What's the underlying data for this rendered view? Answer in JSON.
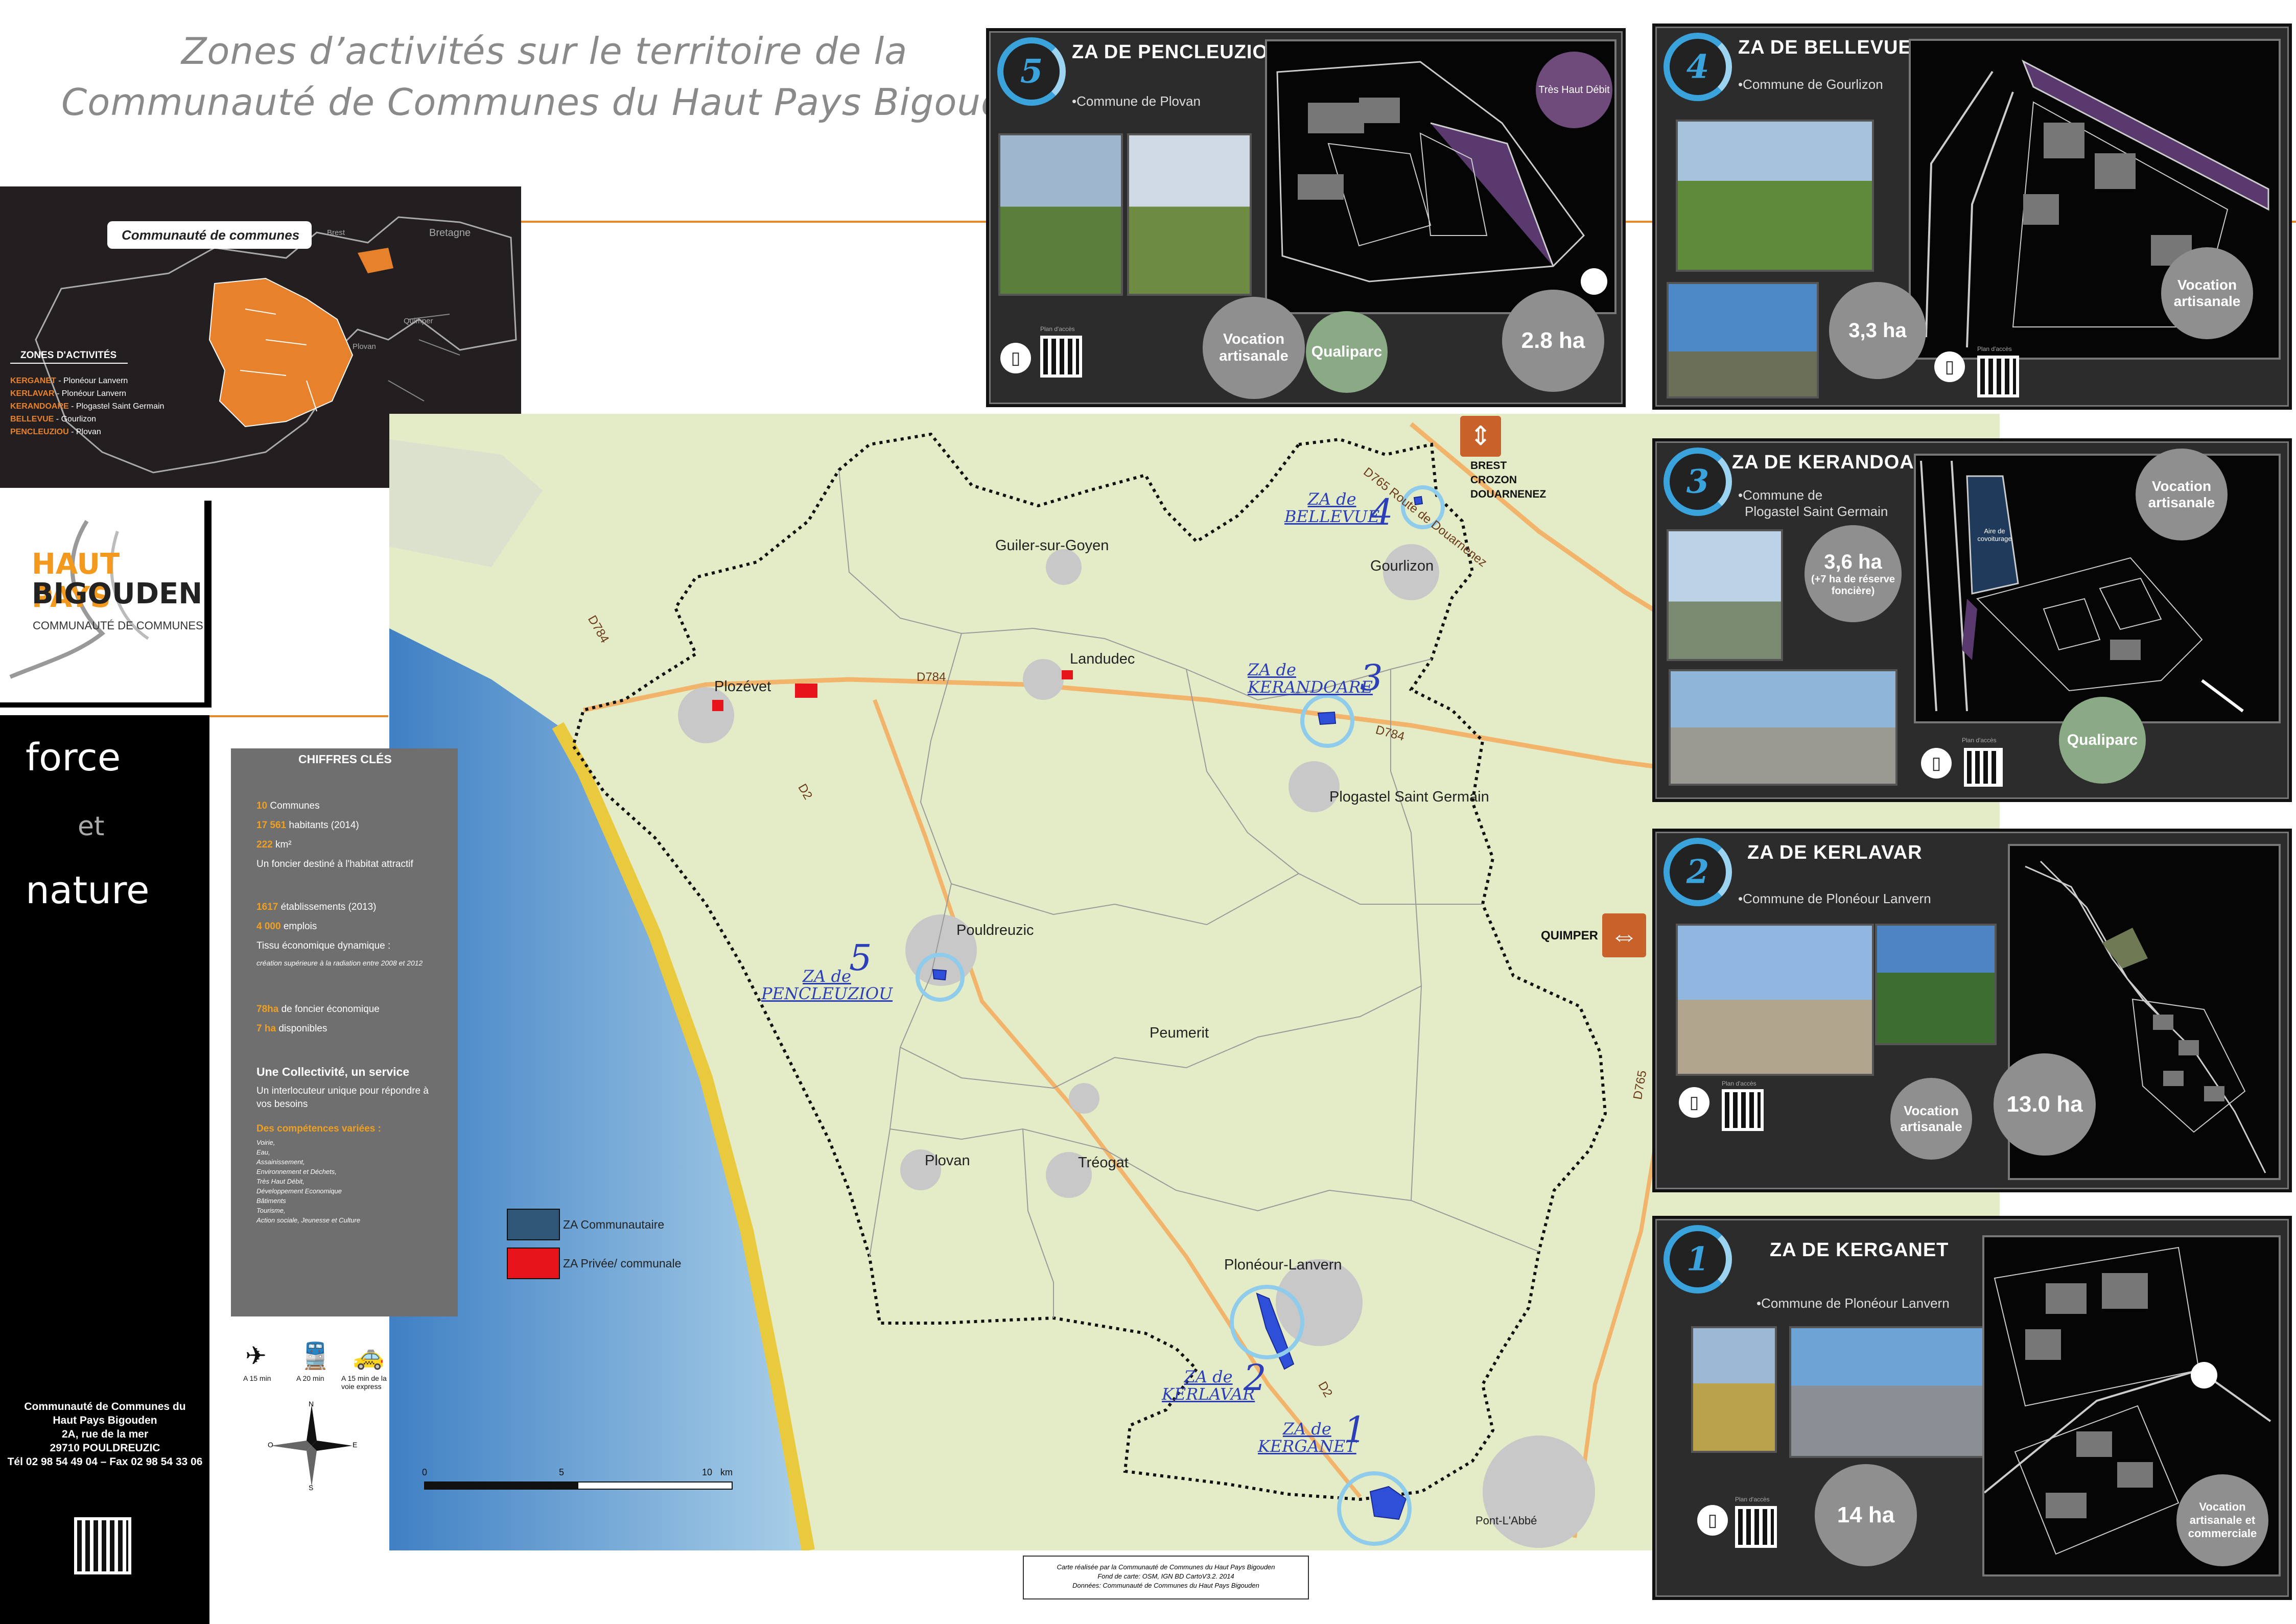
{
  "title": {
    "line1": "Zones d’activités sur le territoire de la",
    "line2": "Communauté de Communes du Haut Pays Bigouden"
  },
  "inset_map": {
    "heading": "Communauté de communes",
    "towns": [
      "Brest",
      "Quimper",
      "Plovan"
    ],
    "regions": [
      "Bretagne"
    ],
    "legend_title": "ZONES D'ACTIVITÉS",
    "legend": [
      {
        "name": "KERGANET",
        "place": "Plonéour Lanvern"
      },
      {
        "name": "KERLAVAR",
        "place": "Plonéour Lanvern"
      },
      {
        "name": "KERANDOARE",
        "place": "Plogastel Saint Germain"
      },
      {
        "name": "BELLEVUE",
        "place": "Gourlizon"
      },
      {
        "name": "PENCLEUZIOU",
        "place": "Plovan"
      }
    ]
  },
  "logo": {
    "line1": "HAUT PAYS",
    "line2": "BIGOUDEN",
    "tagline": "COMMUNAUTÉ DE COMMUNES"
  },
  "motto": {
    "w1": "force",
    "w2": "et",
    "w3": "nature"
  },
  "address": {
    "l1": "Communauté de Communes du",
    "l2": "Haut Pays Bigouden",
    "l3": "2A, rue de la mer",
    "l4": "29710 POULDREUZIC",
    "l5": "Tél 02 98 54 49 04 – Fax 02 98 54 33 06"
  },
  "key_figures": {
    "heading": "CHIFFRES CLÉS",
    "lines": [
      {
        "hi": "10",
        "text": "Communes"
      },
      {
        "hi": "17 561",
        "text": "habitants (2014)"
      },
      {
        "hi": "222",
        "text": "km²"
      },
      {
        "hi": "",
        "text": "Un foncier destiné à l'habitat attractif"
      },
      {
        "hi": "1617",
        "text": "établissements (2013)"
      },
      {
        "hi": "4 000",
        "text": "emplois"
      },
      {
        "hi": "",
        "text": "Tissu économique dynamique :"
      },
      {
        "hi": "",
        "text": "création supérieure à la radiation entre 2008 et 2012"
      },
      {
        "hi": "78ha",
        "text": "de foncier économique"
      },
      {
        "hi": "7 ha",
        "text": "disponibles"
      }
    ],
    "service_heading": "Une Collectivité, un service",
    "service_line1": "Un interlocuteur unique pour répondre à",
    "service_line2": "vos besoins",
    "skills_heading": "Des compétences variées :",
    "skills": [
      "Voirie,",
      "Eau,",
      "Assainissement,",
      "Environnement et Déchets,",
      "Très Haut Débit,",
      "Développement Economique",
      "Bâtiments",
      "Tourisme,",
      "Action sociale, Jeunesse et Culture"
    ]
  },
  "transport": [
    {
      "icon": "plane-icon",
      "label": "A 15 min"
    },
    {
      "icon": "train-icon",
      "label": "A 20 min"
    },
    {
      "icon": "car-icon",
      "label": "A 15 min de la voie express"
    }
  ],
  "map": {
    "places": [
      "Guiler-sur-Goyen",
      "Gourlizon",
      "Landudec",
      "Plozévet",
      "Plogastel Saint Germain",
      "Pouldreuzic",
      "Peumerit",
      "Plovan",
      "Tréogat",
      "Plonéour-Lanvern",
      "Pont-L'Abbé"
    ],
    "roads": [
      "D784",
      "D765 Route de Douarnenez",
      "D2",
      "D765"
    ],
    "zones": [
      {
        "n": "1",
        "l1": "ZA de",
        "l2": "KERGANET"
      },
      {
        "n": "2",
        "l1": "ZA de",
        "l2": "KERLAVAR"
      },
      {
        "n": "3",
        "l1": "ZA de",
        "l2": "KERANDOARE"
      },
      {
        "n": "4",
        "l1": "ZA de",
        "l2": "BELLEVUE"
      },
      {
        "n": "5",
        "l1": "ZA de",
        "l2": "PENCLEUZIOU"
      }
    ],
    "legend": [
      {
        "label": "ZA Communautaire",
        "color": "#2f5778"
      },
      {
        "label": "ZA Privée/ communale",
        "color": "#e8141c"
      }
    ],
    "directions": [
      {
        "label": "BREST CROZON DOUARNENEZ"
      },
      {
        "label": "QUIMPER"
      }
    ],
    "scale": [
      "0",
      "5",
      "10",
      "km"
    ],
    "compass": [
      "N",
      "E",
      "S",
      "O"
    ]
  },
  "credits": {
    "l1": "Carte réalisée par la Communauté de Communes du Haut Pays Bigouden",
    "l2": "Fond de carte: OSM, IGN BD CartoV3.2. 2014",
    "l3": "Données: Communauté de Communes du Haut Pays Bigouden"
  },
  "panels": {
    "p5": {
      "num": "5",
      "title": "ZA DE PENCLEUZIOU",
      "commune": "•Commune de Plovan",
      "b1": "Vocation artisanale",
      "b2": "Qualiparc",
      "b3": "2.8 ha",
      "b4": "Très Haut Débit",
      "qr": "Plan d'accès"
    },
    "p4": {
      "num": "4",
      "title": "ZA DE BELLEVUE",
      "commune": "•Commune de Gourlizon",
      "b1": "3,3 ha",
      "b2": "Vocation artisanale",
      "qr": "Plan d'accès"
    },
    "p3": {
      "num": "3",
      "title": "ZA DE KERANDOARE",
      "commune1": "•Commune de",
      "commune2": "Plogastel Saint Germain",
      "b1": "3,6 ha",
      "b1sub": "(+7 ha de réserve foncière)",
      "b2": "Vocation artisanale",
      "b3": "Qualiparc",
      "plan_label1": "Aire de",
      "plan_label2": "covoiturage",
      "qr": "Plan d'accès"
    },
    "p2": {
      "num": "2",
      "title": "ZA DE KERLAVAR",
      "commune": "•Commune de Plonéour Lanvern",
      "b1": "Vocation artisanale",
      "b2": "13.0 ha",
      "qr": "Plan d'accès"
    },
    "p1": {
      "num": "1",
      "title": "ZA DE KERGANET",
      "commune": "•Commune de Plonéour Lanvern",
      "b1": "14 ha",
      "b2": "Vocation artisanale et commerciale",
      "qr": "Plan d'accès"
    }
  }
}
